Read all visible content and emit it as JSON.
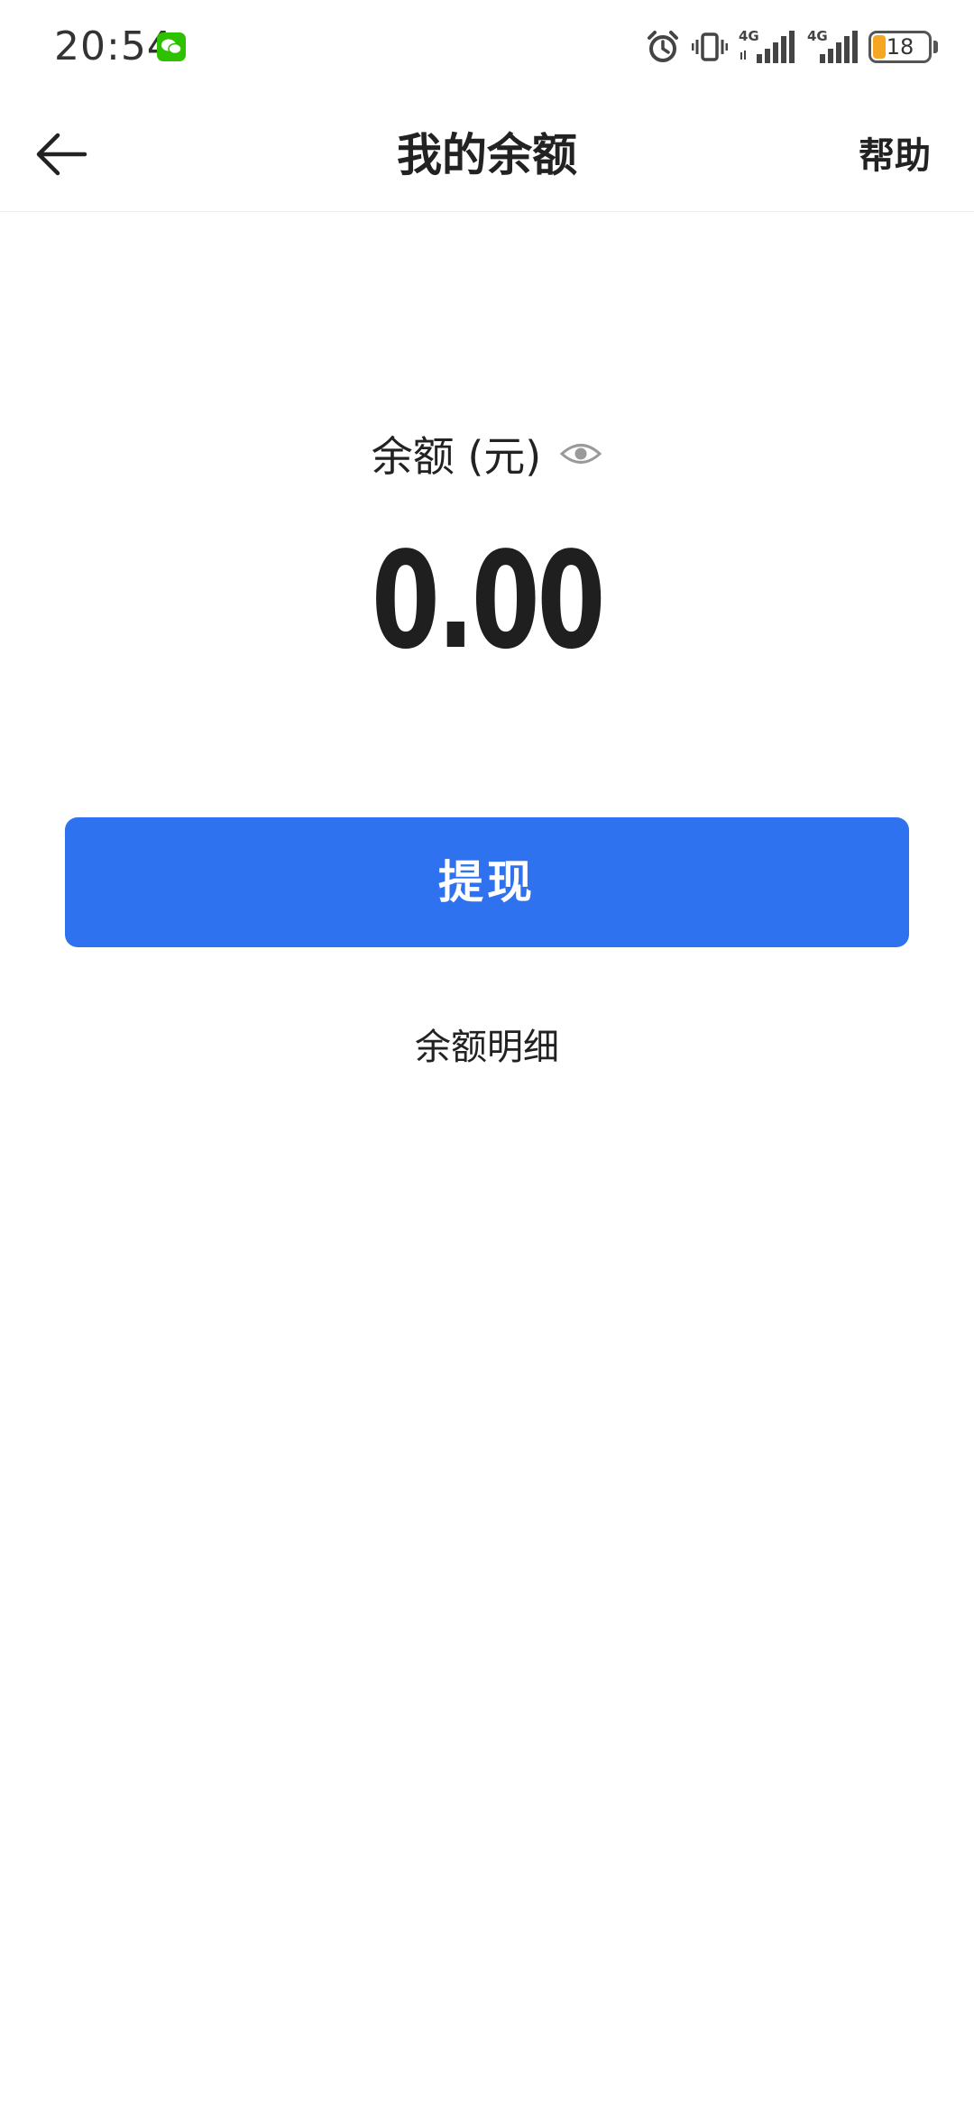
{
  "status_bar": {
    "time": "20:54",
    "battery_level": "18",
    "network_1": "4G",
    "network_2": "4G",
    "icons": [
      "wechat-icon",
      "alarm-icon",
      "vibrate-icon",
      "signal-icon",
      "signal-icon",
      "battery-icon"
    ]
  },
  "header": {
    "title": "我的余额",
    "help_label": "帮助",
    "back_icon": "back-arrow-icon"
  },
  "balance": {
    "label": "余额 (元)",
    "amount": "0.00",
    "visibility_icon": "eye-icon"
  },
  "actions": {
    "withdraw_label": "提现",
    "details_label": "余额明细"
  },
  "colors": {
    "accent": "#2f72f0",
    "wechat": "#2dc100",
    "battery_low": "#f5a623"
  }
}
